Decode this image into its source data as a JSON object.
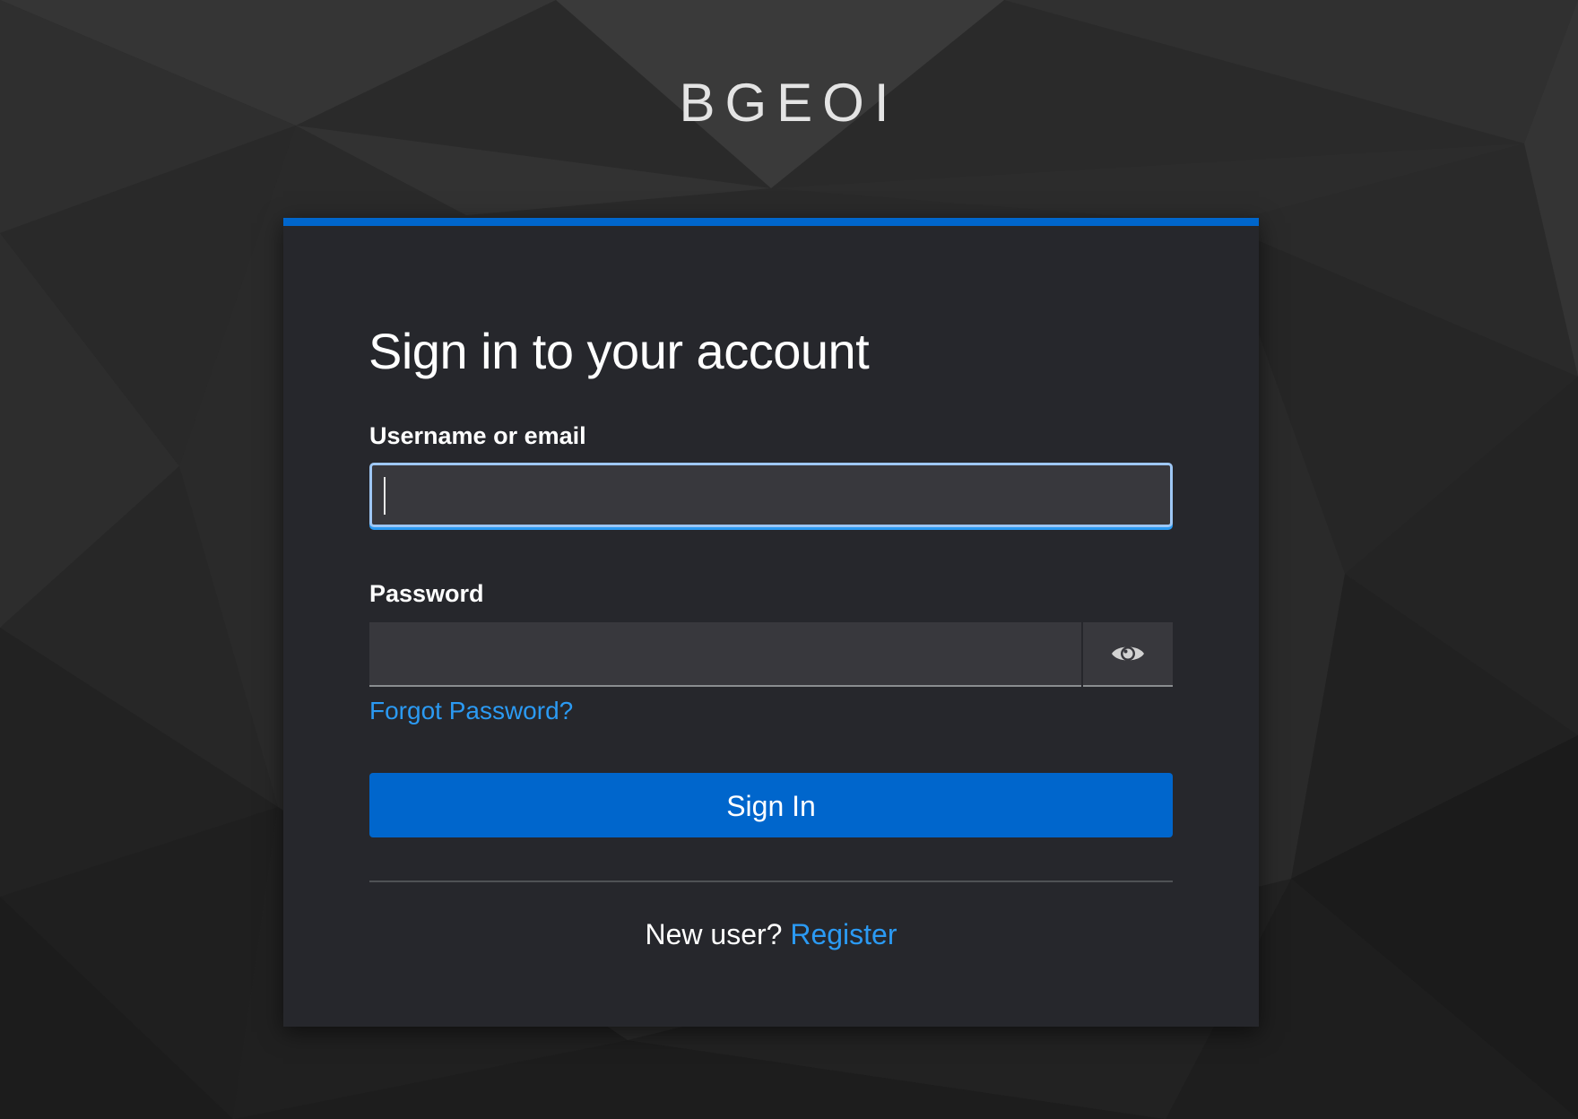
{
  "brand": {
    "name": "BGEOI"
  },
  "login": {
    "title": "Sign in to your account",
    "username_label": "Username or email",
    "username_value": "",
    "password_label": "Password",
    "password_value": "",
    "show_password_icon": "eye-icon",
    "forgot_password": "Forgot Password?",
    "sign_in_button": "Sign In",
    "new_user_text": "New user?",
    "register_link": "Register"
  },
  "colors": {
    "background": "#2b2b2b",
    "card": "#26272c",
    "accent": "#0066cc",
    "link": "#2b9af3",
    "input": "#38383d",
    "focus_border": "#9ec7f5"
  }
}
